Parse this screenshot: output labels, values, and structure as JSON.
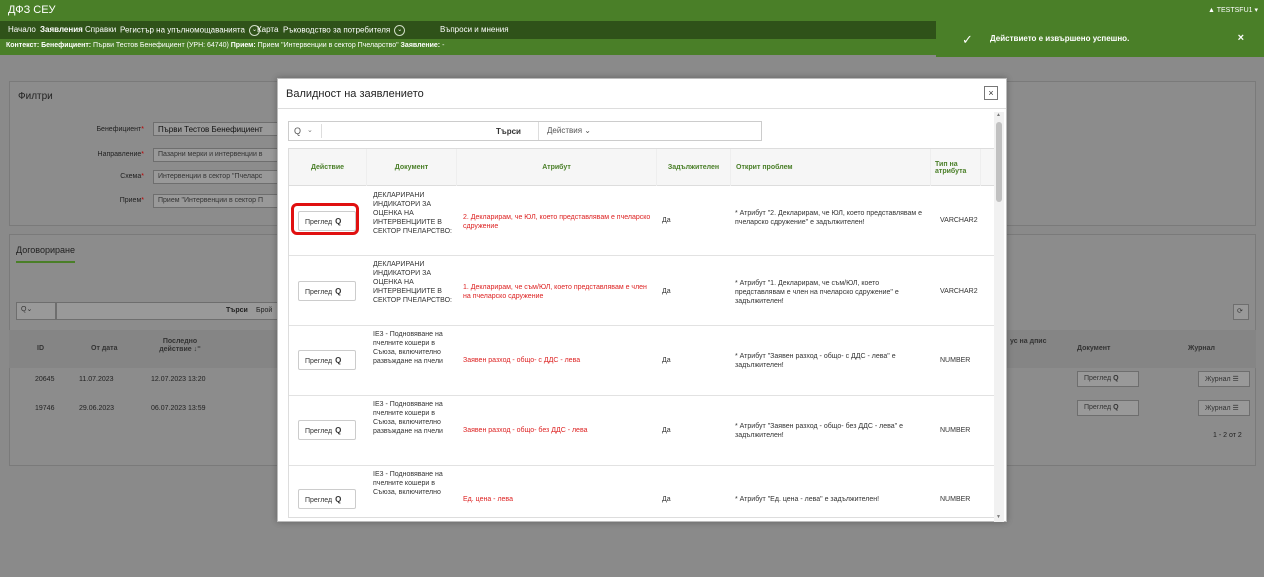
{
  "app": {
    "title": "ДФЗ СЕУ",
    "user": "TESTSFU1"
  },
  "nav": {
    "items": [
      "Начало",
      "Заявления",
      "Справки",
      "Регистър на упълномощаванията",
      "Карта",
      "Ръководство за потребителя",
      "Въпроси и мнения"
    ],
    "dropdown_glyph": "⌄"
  },
  "context": {
    "label1": "Контекст:",
    "k1": "Бенефициент:",
    "v1": "Първи Тестов Бенефициент (УРН: 64740)",
    "k2": "Прием:",
    "v2": "Прием \"Интервенции в сектор Пчеларство\"",
    "k3": "Заявление:",
    "v3": "-"
  },
  "toast": {
    "icon": "check-icon",
    "message": "Действието е извършено успешно.",
    "close": "×"
  },
  "filters": {
    "title": "Филтри",
    "fields": [
      {
        "label": "Бенефициент",
        "value": "Първи Тестов Бенефициент"
      },
      {
        "label": "Направление",
        "value": "Пазарни мерки и интервенции в"
      },
      {
        "label": "Схема",
        "value": "Интервенции в сектор \"Пчеларс"
      },
      {
        "label": "Прием",
        "value": "Прием \"Интервенции в сектор П"
      }
    ]
  },
  "contracting": {
    "tab": "Договориране"
  },
  "bg_table": {
    "search_btn": "Търси",
    "rows_label": "Брой",
    "headers": {
      "id": "ID",
      "from": "От дата",
      "last": "Последно действие ↓⁼",
      "status": "ус на дпис",
      "doc": "Документ",
      "journal": "Журнал"
    },
    "rows": [
      {
        "id": "20645",
        "from": "11.07.2023",
        "last": "12.07.2023 13:20"
      },
      {
        "id": "19746",
        "from": "29.06.2023",
        "last": "06.07.2023 13:59"
      }
    ],
    "review_label": "Преглед",
    "journal_label": "Журнал",
    "pager": "1 - 2 от 2"
  },
  "modal": {
    "title": "Валидност на заявлението",
    "close": "×",
    "search_icon": "search-icon",
    "search_button": "Търси",
    "actions_button": "Действия ⌄",
    "columns": [
      "Действие",
      "Документ",
      "Атрибут",
      "Задължителен",
      "Открит проблем",
      "Тип на атрибута"
    ],
    "review_label": "Преглед",
    "rows": [
      {
        "document": "ДЕКЛАРИРАНИ ИНДИКАТОРИ ЗА ОЦЕНКА НА ИНТЕРВЕНЦИИТЕ В СЕКТОР ПЧЕЛАРСТВО:",
        "attribute": "2. Декларирам, че ЮЛ, което представлявам е пчеларско сдружение",
        "mandatory": "Да",
        "problem": "* Атрибут \"2. Декларирам, че ЮЛ, което представлявам е пчеларско сдружение\" е задължителен!",
        "type": "VARCHAR2"
      },
      {
        "document": "ДЕКЛАРИРАНИ ИНДИКАТОРИ ЗА ОЦЕНКА НА ИНТЕРВЕНЦИИТЕ В СЕКТОР ПЧЕЛАРСТВО:",
        "attribute": "1. Декларирам, че съм/ЮЛ, което представлявам е член на пчеларско сдружение",
        "mandatory": "Да",
        "problem": "* Атрибут \"1. Декларирам, че съм/ЮЛ, което представлявам е член на пчеларско сдружение\" е задължителен!",
        "type": "VARCHAR2"
      },
      {
        "document": "IE3 - Подновяване на пчелните кошери в Съюза, включително развъждане на пчели",
        "attribute": "Заявен разход - общо- с ДДС - лева",
        "mandatory": "Да",
        "problem": "* Атрибут \"Заявен разход - общо- с ДДС - лева\" е задължителен!",
        "type": "NUMBER"
      },
      {
        "document": "IE3 - Подновяване на пчелните кошери в Съюза, включително развъждане на пчели",
        "attribute": "Заявен разход - общо- без ДДС - лева",
        "mandatory": "Да",
        "problem": "* Атрибут \"Заявен разход - общо- без ДДС - лева\" е задължителен!",
        "type": "NUMBER"
      },
      {
        "document": "IE3 - Подновяване на пчелните кошери в Съюза, включително",
        "attribute": "Ед. цена - лева",
        "mandatory": "Да",
        "problem": "* Атрибут \"Ед. цена - лева\" е задължителен!",
        "type": "NUMBER"
      }
    ]
  },
  "colors": {
    "brand": "#4a7f28",
    "brand_dark": "#2f5219",
    "highlight": "#e01010",
    "attribute": "#d22222"
  }
}
